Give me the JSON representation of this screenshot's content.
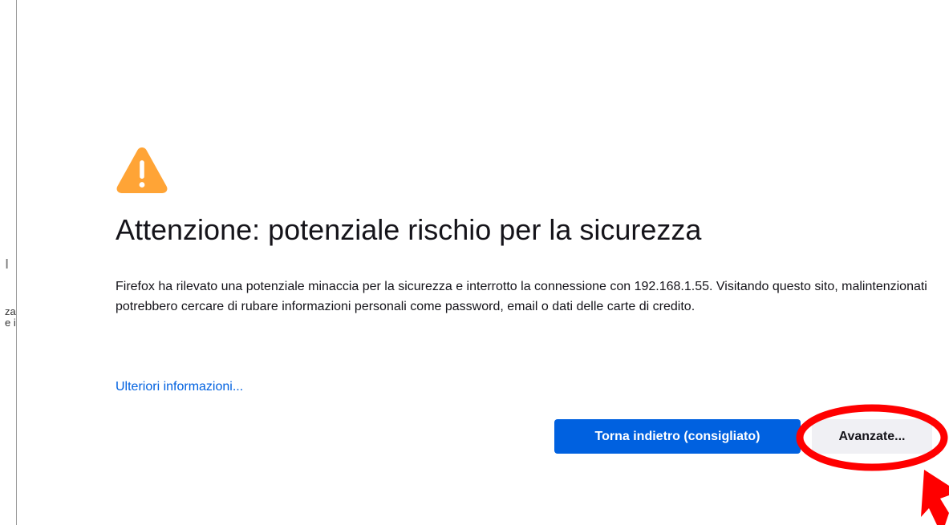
{
  "left_fragment": {
    "line1": "ו",
    "line2": "za",
    "line3": "e i"
  },
  "error_page": {
    "icon": "warning-triangle-icon",
    "icon_color": "#ffa436",
    "title": "Attenzione: potenziale rischio per la sicurezza",
    "description": "Firefox ha rilevato una potenziale minaccia per la sicurezza e interrotto la connessione con 192.168.1.55. Visitando questo sito, malintenzionati potrebbero cercare di rubare informazioni personali come password, email o dati delle carte di credito.",
    "learn_more_link": "Ulteriori informazioni...",
    "back_button_label": "Torna indietro (consigliato)",
    "advanced_button_label": "Avanzate..."
  },
  "colors": {
    "primary_button": "#0061e0",
    "link": "#0061e0",
    "secondary_button": "#f0f0f4",
    "annotation": "#ff0000"
  }
}
